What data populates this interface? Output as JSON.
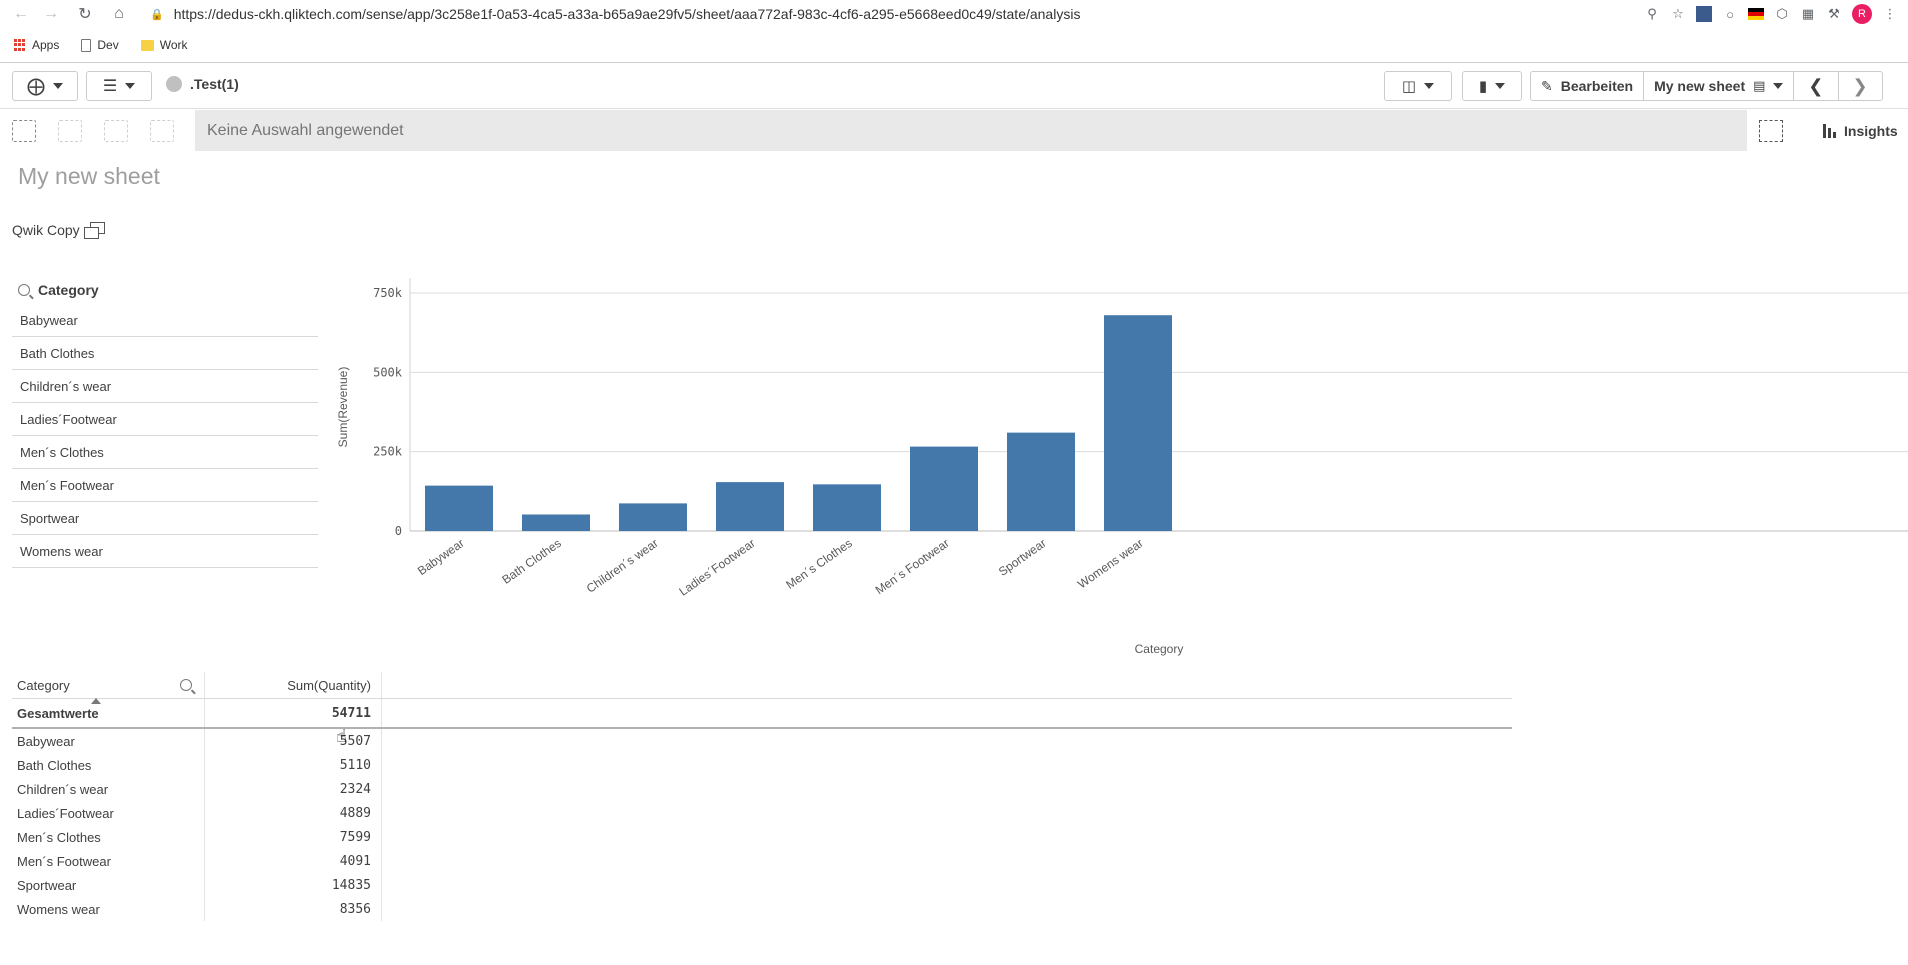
{
  "browser": {
    "url": "https://dedus-ckh.qliktech.com/sense/app/3c258e1f-0a53-4ca5-a33a-b65a9ae29fv5/sheet/aaa772af-983c-4cf6-a295-e5668eed0c49/state/analysis",
    "bookmarks": [
      "Apps",
      "Dev",
      "Work"
    ],
    "avatar_initial": "R"
  },
  "toolbar": {
    "app_name": ".Test(1)",
    "edit_label": "Bearbeiten",
    "sheet_label": "My new sheet"
  },
  "selections": {
    "placeholder": "Keine Auswahl angewendet",
    "insights_label": "Insights"
  },
  "sheet": {
    "title": "My new sheet",
    "qwik_copy": "Qwik Copy"
  },
  "filter": {
    "title": "Category",
    "items": [
      "Babywear",
      "Bath Clothes",
      "Children´s wear",
      "Ladies´Footwear",
      "Men´s Clothes",
      "Men´s Footwear",
      "Sportwear",
      "Womens wear"
    ]
  },
  "chart_data": {
    "type": "bar",
    "categories": [
      "Babywear",
      "Bath Clothes",
      "Children´s wear",
      "Ladies´Footwear",
      "Men´s Clothes",
      "Men´s Footwear",
      "Sportwear",
      "Womens wear"
    ],
    "values": [
      143000,
      52000,
      87000,
      154000,
      147000,
      266000,
      310000,
      680000
    ],
    "xlabel": "Category",
    "ylabel": "Sum(Revenue)",
    "ylim": [
      0,
      750000
    ],
    "yticks": [
      0,
      250000,
      500000,
      750000
    ],
    "ytick_labels": [
      "0",
      "250k",
      "500k",
      "750k"
    ],
    "bar_color": "#4477aa",
    "grid": true
  },
  "table": {
    "headers": [
      "Category",
      "Sum(Quantity)"
    ],
    "total_label": "Gesamtwerte",
    "total_value": "54711",
    "rows": [
      [
        "Babywear",
        "5507"
      ],
      [
        "Bath Clothes",
        "5110"
      ],
      [
        "Children´s wear",
        "2324"
      ],
      [
        "Ladies´Footwear",
        "4889"
      ],
      [
        "Men´s Clothes",
        "7599"
      ],
      [
        "Men´s Footwear",
        "4091"
      ],
      [
        "Sportwear",
        "14835"
      ],
      [
        "Womens wear",
        "8356"
      ]
    ]
  }
}
